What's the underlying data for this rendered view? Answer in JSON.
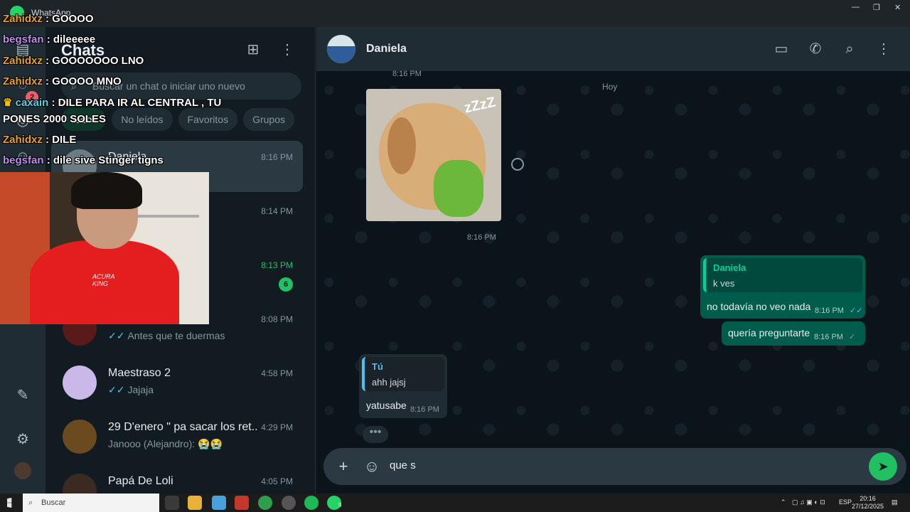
{
  "window": {
    "title": "WhatsApp",
    "controls": [
      "—",
      "❐",
      "✕"
    ]
  },
  "sidebar_rail": {
    "badge": "2"
  },
  "chat_list": {
    "title": "Chats",
    "search_placeholder": "Buscar un chat o iniciar uno nuevo",
    "filters": [
      "Todos",
      "No leídos",
      "Favoritos",
      "Grupos"
    ],
    "items": [
      {
        "name": "Daniela",
        "preview": "",
        "time": "8:16 PM",
        "selected": true
      },
      {
        "name": "",
        "preview": "",
        "time": "8:14 PM"
      },
      {
        "name": "",
        "preview": "",
        "time": "8:13 PM",
        "unread": "6"
      },
      {
        "name": "",
        "preview": "Antes que te duermas",
        "time": "8:08 PM"
      },
      {
        "name": "Maestraso 2",
        "preview": "Jajaja",
        "time": "4:58 PM"
      },
      {
        "name": "29 D'enero \" pa sacar los ret...",
        "preview": "Janooo (Alejandro): 😭😭",
        "time": "4:29 PM"
      },
      {
        "name": "Papá De Loli",
        "preview": "",
        "time": "4:05 PM"
      }
    ]
  },
  "conversation": {
    "contact": "Daniela",
    "day_label": "Hoy",
    "top_time": "8:16 PM",
    "photo_caption_time": "8:16 PM",
    "photo_text": "zZzZ",
    "outgoing": [
      {
        "quote_name": "Daniela",
        "quote_text": "k ves",
        "text": "no todavía no veo nada",
        "time": "8:16 PM"
      },
      {
        "text": "quería preguntarte",
        "time": "8:16 PM"
      }
    ],
    "incoming": {
      "quote_name": "Tú",
      "quote_text": "ahh jajsj",
      "text": "yatusabe",
      "time": "8:16 PM"
    },
    "typing": "•••",
    "composer_text": "que s"
  },
  "stream_overlay": {
    "chat": [
      {
        "user": "Zahidxz",
        "msg": ": GOOOO",
        "color": "u1"
      },
      {
        "user": "begsfan",
        "msg": ": dileeeee",
        "color": "u2"
      },
      {
        "user": "Zahidxz",
        "msg": ": GOOOOOOO LNO",
        "color": "u1"
      },
      {
        "user": "Zahidxz",
        "msg": ": GOOOO MNO",
        "color": "u1"
      },
      {
        "user": "caxain",
        "msg": ": DILE PARA IR AL CENTRAL , TU",
        "color": "u3"
      },
      {
        "user": "",
        "msg": "PONES 2000 SOLES",
        "color": ""
      },
      {
        "user": "Zahidxz",
        "msg": ": DILE",
        "color": "u1"
      },
      {
        "user": "begsfan",
        "msg": ": dile sive Stinger tigns",
        "color": "u2"
      }
    ],
    "shirt_text": "ACURA KING"
  },
  "taskbar": {
    "search_label": "Buscar",
    "lang": "ESP",
    "time": "20:16",
    "date": "27/12/2025",
    "whatsapp_badge": "9"
  },
  "colors": {
    "accent": "#21c063",
    "outgoing_bubble": "#005c4b",
    "incoming_bubble": "#202c33",
    "read_tick": "#53bdeb"
  }
}
